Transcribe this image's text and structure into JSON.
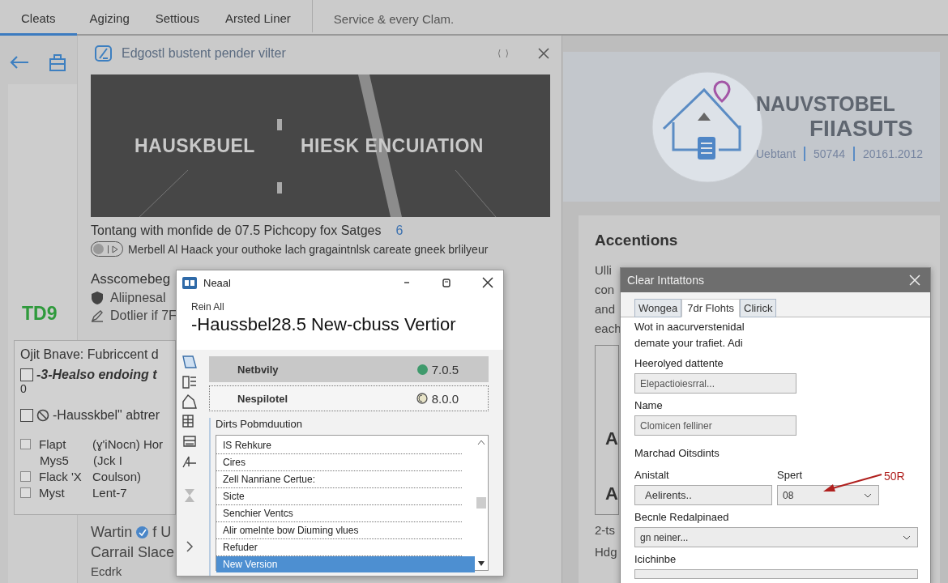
{
  "top_tabs": [
    {
      "label": "Cleats",
      "selected": true
    },
    {
      "label": "Agizing",
      "selected": false
    },
    {
      "label": "Settious",
      "selected": false
    },
    {
      "label": "Arsted Liner",
      "selected": false
    }
  ],
  "service_link": "Service & every Clam.",
  "rail": {
    "badge": "TD9"
  },
  "main_panel": {
    "title": "Edgostl bustent pender vilter",
    "banner": {
      "left_text": "HAUSKBUEL",
      "right_text": "HIESK ENCUIATION"
    },
    "caption": "Tontang with monfide de 07.5 Pichcopy fox Satges",
    "caption_badge": "6",
    "toggle": {
      "on": false
    },
    "toggle_text": "Merbell Al Haack your outhoke lach gragaintnlsk careate gneek brlilyeur",
    "section_title": "Asscomebeg",
    "items": [
      {
        "kind": "shield",
        "text": "Aliipnesal"
      },
      {
        "kind": "edit",
        "text": "Dotlier if 7F"
      }
    ],
    "footer": [
      {
        "kind": "check",
        "text": "Wartin",
        "after": "f U"
      },
      {
        "kind": "plain",
        "text": "Carrail Slace"
      },
      {
        "kind": "link",
        "text": "Ecdrk"
      }
    ]
  },
  "filter_card": {
    "title": "Ojit Bnave: Fubriccent d",
    "options": [
      {
        "checked": false,
        "text": "-3-Healso endoing t",
        "note": "0"
      },
      {
        "checked": false,
        "text": "-Hausskbel\" abtrer"
      }
    ],
    "rows": [
      {
        "kind": "check",
        "checked": false,
        "name": "Flapt",
        "value": "(ɣ'iNocn) Hor"
      },
      {
        "kind": "plain",
        "name": "Mys5",
        "value": "(Jck I"
      },
      {
        "kind": "check",
        "checked": false,
        "name": "Flack 'X",
        "value": "Coulson)"
      },
      {
        "kind": "check",
        "checked": false,
        "name": "Myst",
        "value": "Lent-7"
      }
    ]
  },
  "brand": {
    "line1": "NAUVSTOBEL",
    "line2": "FIIASUTS",
    "meta": [
      "Uebtant",
      "50744",
      "20161.2012"
    ]
  },
  "accent_card": {
    "title": "Accentions",
    "lines": [
      "Ulli",
      "con",
      "and",
      "each"
    ],
    "letters": [
      "A",
      "A"
    ],
    "footer": [
      "2-ts",
      "Hdg"
    ]
  },
  "installer": {
    "title": "Neaal",
    "subtitle": "Rein All",
    "heading": "-Haussbel28.5 New-cbuss Vertior",
    "packages": [
      {
        "name": "Netbvily",
        "version": "7.0.5",
        "selected": true,
        "kind": "ok"
      },
      {
        "name": "Nespilotel",
        "version": "8.0.0",
        "selected": false,
        "kind": "pending"
      }
    ],
    "list_title": "Dirts Pobmduution",
    "list": [
      {
        "text": "IS Rehkure",
        "selected": false
      },
      {
        "text": "Cires",
        "selected": false
      },
      {
        "text": "Zell Nanriane Certue:",
        "selected": false
      },
      {
        "text": "Sicte",
        "selected": false
      },
      {
        "text": "Senchier Ventcs",
        "selected": false
      },
      {
        "text": "Alir omelnte bow Diuming vlues",
        "selected": false
      },
      {
        "text": "Refuder",
        "selected": false
      },
      {
        "text": "New Version",
        "selected": true
      }
    ]
  },
  "settings_dialog": {
    "title": "Clear Inttattons",
    "tabs": [
      {
        "label": "Wongea",
        "selected": false
      },
      {
        "label": "7dr Flohts",
        "selected": true
      },
      {
        "label": "Clirick",
        "selected": false
      }
    ],
    "intro": "Wot in aacurverstenidal demate your trafiet. Adi",
    "fields": [
      {
        "label": "Heerolyed dattente",
        "value": "Elepactioiesrral..."
      },
      {
        "label": "Name",
        "value": "Clomicen felliner"
      }
    ],
    "section": "Marchad Oitsdints",
    "pair": [
      {
        "kind": "text",
        "label": "Anistalt",
        "value": "Aelirents.."
      },
      {
        "kind": "select",
        "label": "Spert",
        "value": "08"
      }
    ],
    "annotation": "50R",
    "select": {
      "label": "Becnle Redalpinaed",
      "value": "gn neiner..."
    },
    "last_field": {
      "label": "Icichinbe"
    }
  }
}
